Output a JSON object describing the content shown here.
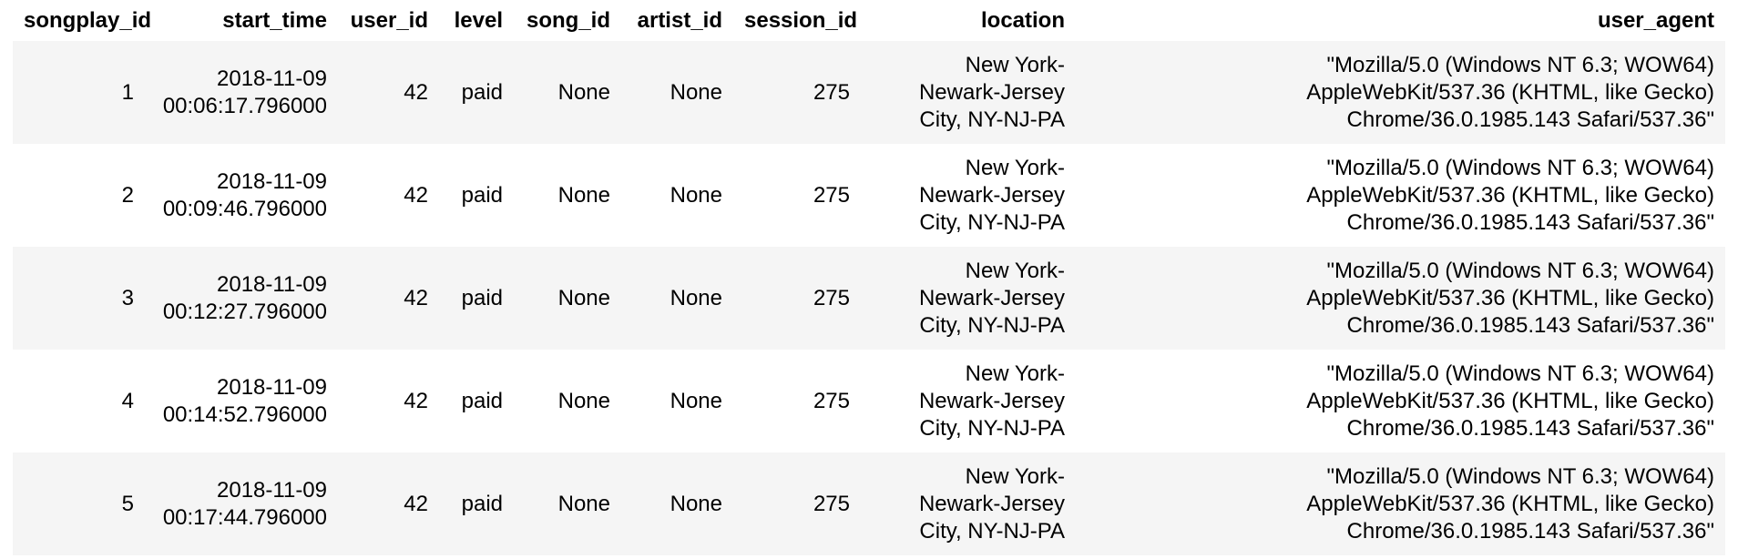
{
  "table": {
    "columns": [
      "songplay_id",
      "start_time",
      "user_id",
      "level",
      "song_id",
      "artist_id",
      "session_id",
      "location",
      "user_agent"
    ],
    "rows": [
      [
        "1",
        "2018-11-09\n00:06:17.796000",
        "42",
        "paid",
        "None",
        "None",
        "275",
        "New York-\nNewark-Jersey\nCity, NY-NJ-PA",
        "\"Mozilla/5.0 (Windows NT 6.3; WOW64)\nAppleWebKit/537.36 (KHTML, like Gecko)\nChrome/36.0.1985.143 Safari/537.36\""
      ],
      [
        "2",
        "2018-11-09\n00:09:46.796000",
        "42",
        "paid",
        "None",
        "None",
        "275",
        "New York-\nNewark-Jersey\nCity, NY-NJ-PA",
        "\"Mozilla/5.0 (Windows NT 6.3; WOW64)\nAppleWebKit/537.36 (KHTML, like Gecko)\nChrome/36.0.1985.143 Safari/537.36\""
      ],
      [
        "3",
        "2018-11-09\n00:12:27.796000",
        "42",
        "paid",
        "None",
        "None",
        "275",
        "New York-\nNewark-Jersey\nCity, NY-NJ-PA",
        "\"Mozilla/5.0 (Windows NT 6.3; WOW64)\nAppleWebKit/537.36 (KHTML, like Gecko)\nChrome/36.0.1985.143 Safari/537.36\""
      ],
      [
        "4",
        "2018-11-09\n00:14:52.796000",
        "42",
        "paid",
        "None",
        "None",
        "275",
        "New York-\nNewark-Jersey\nCity, NY-NJ-PA",
        "\"Mozilla/5.0 (Windows NT 6.3; WOW64)\nAppleWebKit/537.36 (KHTML, like Gecko)\nChrome/36.0.1985.143 Safari/537.36\""
      ],
      [
        "5",
        "2018-11-09\n00:17:44.796000",
        "42",
        "paid",
        "None",
        "None",
        "275",
        "New York-\nNewark-Jersey\nCity, NY-NJ-PA",
        "\"Mozilla/5.0 (Windows NT 6.3; WOW64)\nAppleWebKit/537.36 (KHTML, like Gecko)\nChrome/36.0.1985.143 Safari/537.36\""
      ]
    ]
  },
  "colors": {
    "stripe": "#f5f5f5",
    "background": "#ffffff",
    "text": "#000000"
  }
}
